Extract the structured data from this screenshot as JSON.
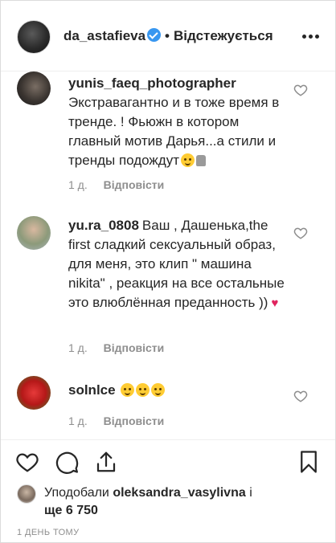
{
  "header": {
    "username": "da_astafieva",
    "separator": "•",
    "follow_status": "Відстежується"
  },
  "comments": [
    {
      "user": "yunis_faeq_photographer",
      "text": "Экстравагантно и в тоже время в тренде. ! Фьюжн в котором главный мотив Дарья...а стили и тренды подождут",
      "age": "1 д.",
      "reply": "Відповісти"
    },
    {
      "user": "yu.ra_0808",
      "text": "Ваш , Дашенька,the first сладкий сексуальный образ, для меня, это клип \" машина nikita\" , реакция на все остальные это влюблённая преданность ))",
      "age": "1 д.",
      "reply": "Відповісти"
    },
    {
      "user": "solnlce",
      "text": "",
      "age": "1 д.",
      "reply": "Відповісти"
    }
  ],
  "likes": {
    "prefix": "Уподобали",
    "user": "oleksandra_vasylivna",
    "conj": "і",
    "others": "ще 6 750"
  },
  "timestamp": "1 ДЕНЬ ТОМУ",
  "colors": {
    "verified": "#3897f0",
    "heart_red": "#e0245e",
    "muted": "#8e8e8e",
    "text": "#262626"
  }
}
